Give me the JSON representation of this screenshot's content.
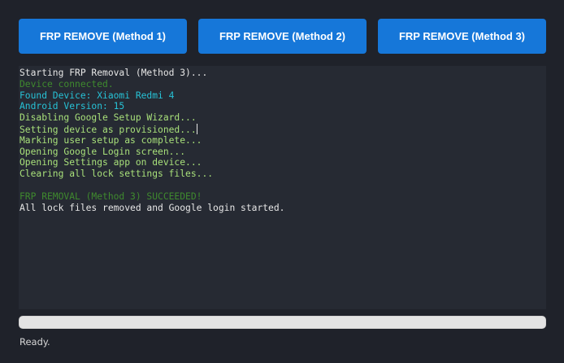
{
  "buttons": [
    {
      "label": "FRP REMOVE (Method 1)"
    },
    {
      "label": "FRP REMOVE (Method 2)"
    },
    {
      "label": "FRP REMOVE (Method 3)"
    }
  ],
  "console": {
    "lines": [
      {
        "text": "Starting FRP Removal (Method 3)...",
        "color": "#e6e6e6"
      },
      {
        "text": "Device connected.",
        "color": "#3f8a2e"
      },
      {
        "text": "Found Device: Xiaomi Redmi 4",
        "color": "#27c2d6"
      },
      {
        "text": "Android Version: 15",
        "color": "#27c2d6"
      },
      {
        "text": "Disabling Google Setup Wizard...",
        "color": "#a8e07a"
      },
      {
        "text": "Setting device as provisioned...",
        "color": "#a8e07a"
      },
      {
        "text": "Marking user setup as complete...",
        "color": "#a8e07a"
      },
      {
        "text": "Opening Google Login screen...",
        "color": "#a8e07a"
      },
      {
        "text": "Opening Settings app on device...",
        "color": "#a8e07a"
      },
      {
        "text": "Clearing all lock settings files...",
        "color": "#a8e07a"
      },
      {
        "text": "",
        "color": "#e6e6e6"
      },
      {
        "text": "FRP REMOVAL (Method 3) SUCCEEDED!",
        "color": "#3f8a2e"
      },
      {
        "text": "All lock files removed and Google login started.",
        "color": "#e6e6e6"
      }
    ]
  },
  "progress": {
    "value": 0,
    "fill_color": "#1677d9",
    "track_color": "#e3e3e3"
  },
  "status": {
    "text": "Ready."
  },
  "colors": {
    "background": "#1f222a",
    "console_bg": "#262a33",
    "accent": "#1677d9"
  }
}
